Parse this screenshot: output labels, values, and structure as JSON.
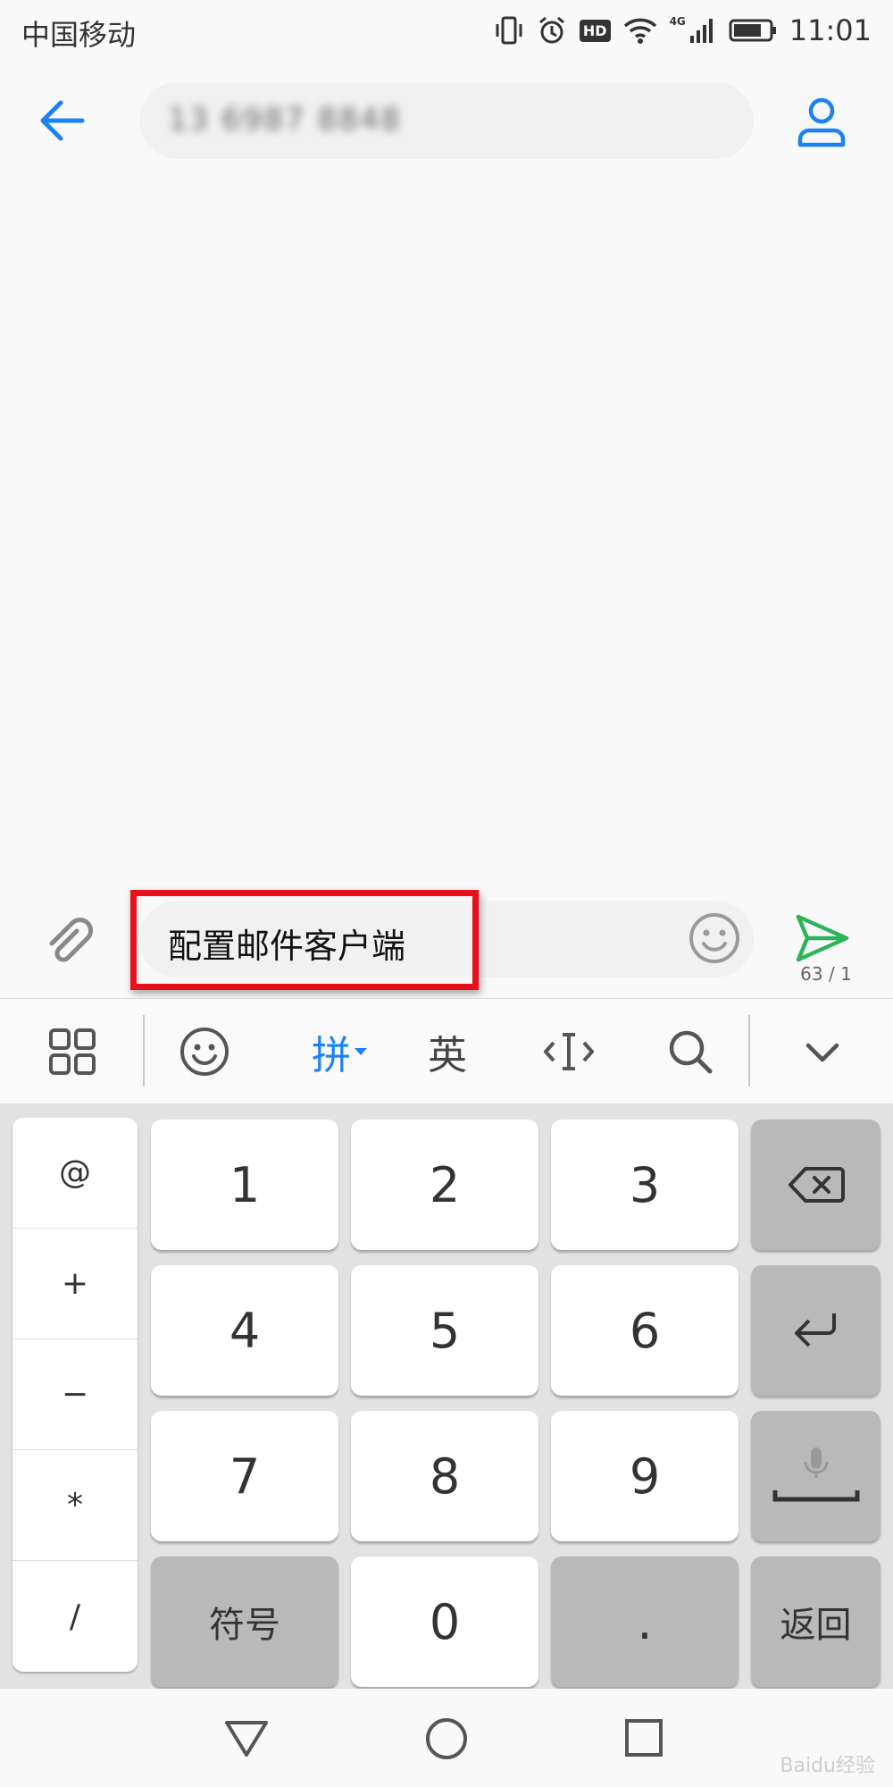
{
  "status_bar": {
    "carrier": "中国移动",
    "hd_badge": "HD",
    "network": "4G",
    "time": "11:01",
    "icons": [
      "vibrate-icon",
      "alarm-icon",
      "hd-icon",
      "wifi-icon",
      "signal-icon",
      "battery-icon"
    ]
  },
  "header": {
    "recipient_number": "13 6987 8848",
    "icons": [
      "back-arrow-icon",
      "contact-icon"
    ]
  },
  "compose": {
    "message_text": "配置邮件客户端",
    "char_counter": "63 / 1",
    "highlight_color": "#e8101a",
    "icons": [
      "paperclip-icon",
      "smiley-icon",
      "send-icon"
    ]
  },
  "keyboard_toolbar": {
    "pinyin_label": "拼",
    "english_label": "英",
    "icons": [
      "grid-icon",
      "emoji-icon",
      "cursor-icon",
      "search-icon",
      "chevron-down-icon"
    ]
  },
  "keyboard": {
    "symbols": [
      "@",
      "+",
      "−",
      "*",
      "/"
    ],
    "digits": [
      "1",
      "2",
      "3",
      "4",
      "5",
      "6",
      "7",
      "8",
      "9"
    ],
    "zero": "0",
    "dot": ".",
    "symbol_key": "符号",
    "back_key": "返回",
    "icons": [
      "backspace-icon",
      "enter-icon",
      "space-mic-icon"
    ]
  },
  "nav_bar": {
    "icons": [
      "back-triangle-icon",
      "home-circle-icon",
      "recents-square-icon"
    ]
  },
  "watermark": "Baidu经验"
}
